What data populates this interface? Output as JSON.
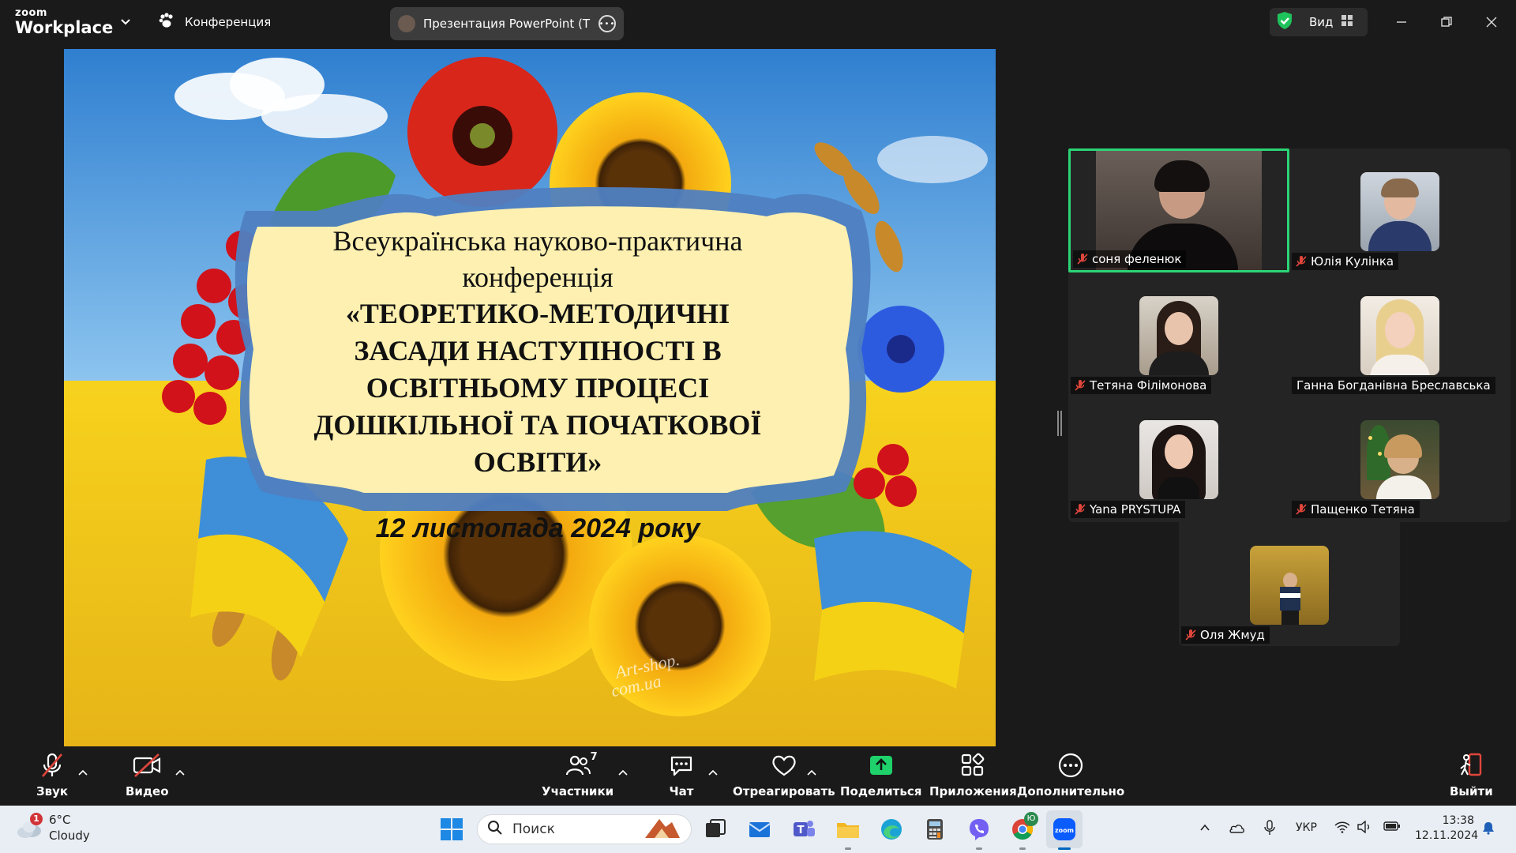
{
  "app": {
    "logo_small": "zoom",
    "logo_big": "Workplace",
    "conference_label": "Конференция",
    "presentation_label": "Презентация PowerPoint (Тетяна",
    "view_label": "Вид"
  },
  "slide": {
    "line1": "Всеукраїнська науково-практична",
    "line2": "конференція",
    "line3": "«ТЕОРЕТИКО-МЕТОДИЧНІ",
    "line4": "ЗАСАДИ НАСТУПНОСТІ В",
    "line5": "ОСВІТНЬОМУ ПРОЦЕСІ",
    "line6": "ДОШКІЛЬНОЇ ТА ПОЧАТКОВОЇ",
    "line7": "ОСВІТИ»",
    "date": "12 листопада 2024 року",
    "watermark_line1": "Art-shop.",
    "watermark_line2": "com.ua"
  },
  "participants": [
    {
      "name": "соня феленюк",
      "active": true
    },
    {
      "name": "Юлія Кулінка",
      "active": false
    },
    {
      "name": "Тетяна Філімонова",
      "active": false
    },
    {
      "name": "Ганна Богданівна Бреславська",
      "active": false
    },
    {
      "name": "Yana PRYSTUPA",
      "active": false
    },
    {
      "name": "Пащенко Тетяна",
      "active": false
    },
    {
      "name": "Оля Жмуд",
      "active": false
    }
  ],
  "controls": {
    "audio": "Звук",
    "video": "Видео",
    "participants": "Участники",
    "participants_count": "7",
    "chat": "Чат",
    "react": "Отреагировать",
    "share": "Поделиться",
    "apps": "Приложения",
    "more": "Дополнительно",
    "leave": "Выйти"
  },
  "taskbar": {
    "weather_temp": "6°C",
    "weather_desc": "Cloudy",
    "weather_badge": "1",
    "search_placeholder": "Поиск",
    "language": "УКР",
    "time": "13:38",
    "date": "12.11.2024",
    "chrome_badge": "Ю"
  },
  "colors": {
    "active_speaker": "#2bd576",
    "share_green": "#1fd16a",
    "leave_red": "#e0463c",
    "muted_red": "#e0463c"
  }
}
